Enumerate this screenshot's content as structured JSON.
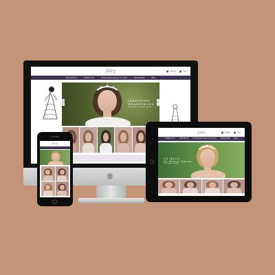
{
  "site": {
    "logo": "fairy",
    "util_links": [
      "Wishlist",
      "Cart"
    ],
    "nav": [
      "PRODUCTS",
      "CONTACTS",
      "Bridesmaid Jewelry for Gifts",
      "MAGAZINE",
      "Blog"
    ],
    "hero_heading": "INSPIRING",
    "hero_heading2": "HEADPIECES",
    "hero_sub": "Hand made in a unique design",
    "tablet_hero_heading": "Un Bacio",
    "tablet_hero_heading2": "Di Dolce Sposa",
    "tablet_hero_sub": "Hand made collection"
  },
  "icons": {
    "prev": "chevron-left-icon",
    "next": "chevron-right-icon",
    "wishlist": "heart-icon",
    "cart": "bag-icon"
  },
  "colors": {
    "background": "#c49478",
    "nav": "#3e3353",
    "accent": "#8a7aa6"
  }
}
